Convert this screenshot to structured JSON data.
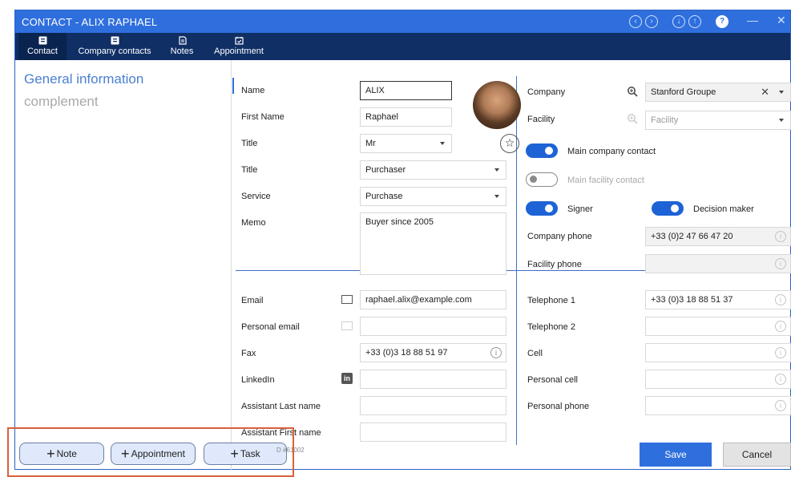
{
  "window": {
    "title": "CONTACT - ALIX RAPHAEL"
  },
  "toolbar": {
    "tabs": [
      {
        "label": "Contact",
        "icon": "contact-card-icon"
      },
      {
        "label": "Company contacts",
        "icon": "contacts-book-icon"
      },
      {
        "label": "Notes",
        "icon": "notes-icon"
      },
      {
        "label": "Appointment",
        "icon": "calendar-check-icon"
      }
    ]
  },
  "sidebar": {
    "items": [
      {
        "label": "General information"
      },
      {
        "label": "complement"
      }
    ]
  },
  "general": {
    "name_label": "Name",
    "name_value": "ALIX",
    "first_name_label": "First Name",
    "first_name_value": "Raphael",
    "title_label": "Title",
    "title_value": "Mr",
    "title2_label": "Title",
    "title2_value": "Purchaser",
    "service_label": "Service",
    "service_value": "Purchase",
    "memo_label": "Memo",
    "memo_value": "Buyer since 2005"
  },
  "company": {
    "company_label": "Company",
    "company_value": "Stanford Groupe",
    "facility_label": "Facility",
    "facility_placeholder": "Facility",
    "main_company_contact_label": "Main company contact",
    "main_facility_contact_label": "Main facility contact",
    "signer_label": "Signer",
    "decision_maker_label": "Decision maker",
    "company_phone_label": "Company phone",
    "company_phone_value": "+33 (0)2 47 66 47 20",
    "facility_phone_label": "Facility phone"
  },
  "contact_info": {
    "email_label": "Email",
    "email_value": "raphael.alix@example.com",
    "personal_email_label": "Personal email",
    "fax_label": "Fax",
    "fax_value": "+33 (0)3 18 88 51 97",
    "linkedin_label": "LinkedIn",
    "assistant_last_label": "Assistant Last name",
    "assistant_first_label": "Assistant First name"
  },
  "phones": {
    "telephone1_label": "Telephone 1",
    "telephone1_value": "+33 (0)3 18 88 51 37",
    "telephone2_label": "Telephone 2",
    "cell_label": "Cell",
    "personal_cell_label": "Personal cell",
    "personal_phone_label": "Personal phone"
  },
  "footer": {
    "note_label": "Note",
    "appointment_label": "Appointment",
    "task_label": "Task",
    "id_text": "D #61002",
    "save_label": "Save",
    "cancel_label": "Cancel"
  },
  "colors": {
    "titlebar": "#2f6fdd",
    "toolbar": "#0f2f65",
    "accent": "#1e63d6",
    "highlight": "#d7613d"
  }
}
